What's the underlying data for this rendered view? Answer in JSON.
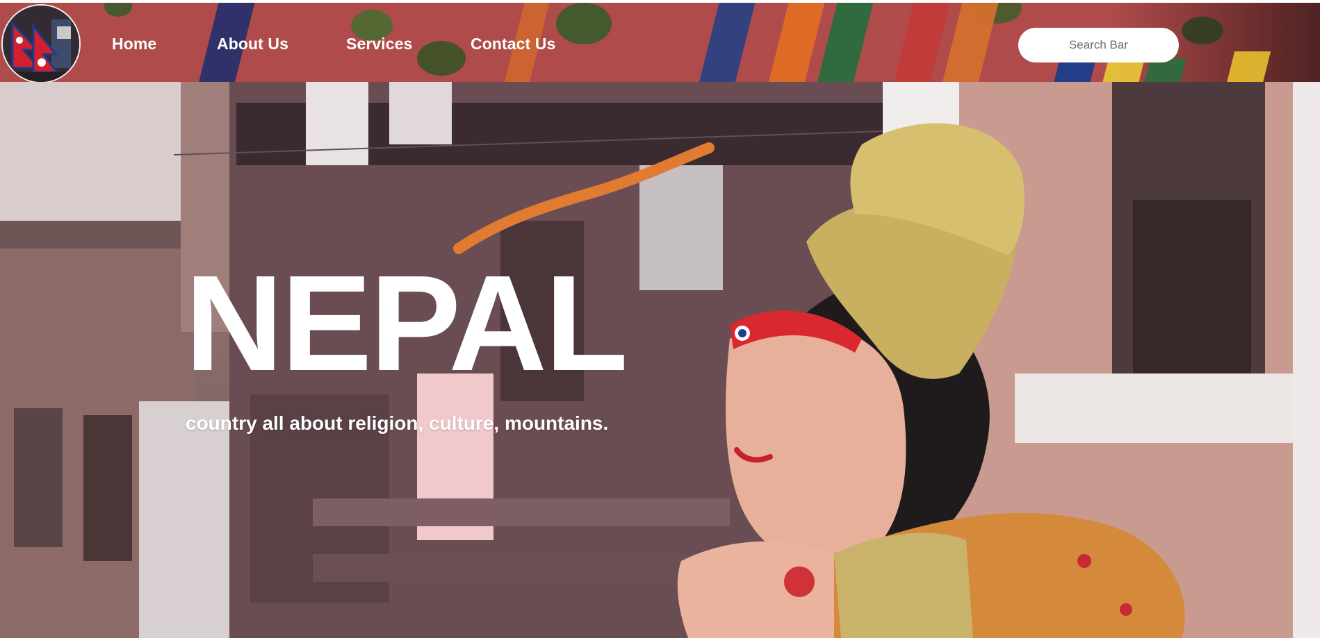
{
  "nav": {
    "links": [
      "Home",
      "About Us",
      "Services",
      "Contact Us"
    ],
    "search_placeholder": "Search Bar",
    "logo_icon": "nepal-flag-collage-icon"
  },
  "hero": {
    "title": "NEPAL",
    "subtitle": "country all about religion, culture, mountains."
  },
  "colors": {
    "navbar_tint": "#b04b4b",
    "text": "#ffffff",
    "search_bg": "#ffffff"
  }
}
